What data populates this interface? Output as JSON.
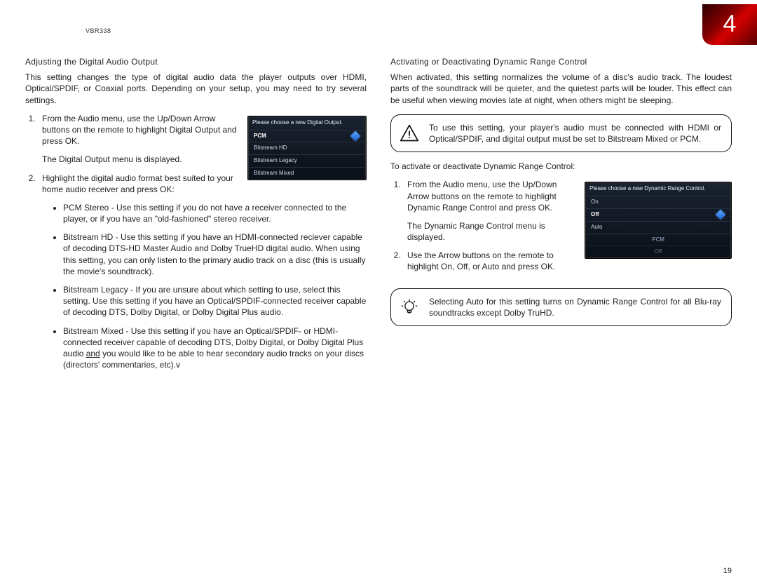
{
  "header": {
    "model": "VBR338",
    "chapter": "4"
  },
  "page_number": "19",
  "left": {
    "title": "Adjusting the Digital Audio Output",
    "intro": "This setting changes the type of digital audio data the player outputs over HDMI, Optical/SPDIF, or Coaxial ports. Depending on your setup, you may need to try several settings.",
    "step1_a": "From the Audio menu, use the ",
    "step1_b": "Up/Down Arrow",
    "step1_c": " buttons on the remote to highlight ",
    "step1_d": "Digital Output",
    "step1_e": " and press ",
    "step1_ok": "OK",
    "step1_f": ".",
    "step1_after": "The Digital Output menu is displayed.",
    "step2_a": "Highlight the digital audio format best suited to your home audio receiver and press ",
    "step2_ok": "OK",
    "step2_b": ":",
    "bullet_pcm_t": "PCM Stereo",
    "bullet_pcm": " - Use this setting if you do not have a receiver connected to the player, or if you have an \"old-fashioned\" stereo receiver.",
    "bullet_hd_t": "Bitstream HD",
    "bullet_hd": " - Use this setting if you have an HDMI-connected reciever capable of decoding DTS-HD Master Audio and Dolby TrueHD digital audio. When using this setting, you can only listen to the primary audio track on a disc (this is usually the movie's soundtrack).",
    "bullet_legacy_t": "Bitstream Legacy",
    "bullet_legacy_lead": " - ",
    "bullet_legacy_bold": "If you are unsure about which setting to use, select this setting.",
    "bullet_legacy": " Use this setting if you have an Optical/SPDIF-connected receiver capable of decoding DTS, Dolby Digital, or Dolby Digital Plus audio.",
    "bullet_mixed_t": "Bitstream Mixed",
    "bullet_mixed_a": " - Use this setting if you have an Optical/SPDIF- or HDMI-connected receiver capable of decoding DTS, Dolby Digital, or Dolby Digital Plus audio ",
    "bullet_mixed_and": "and",
    "bullet_mixed_b": " you would like to be able to hear secondary audio tracks on your discs (directors' commentaries, etc).v",
    "ss": {
      "title": "Please choose a new Digital Output.",
      "opts": [
        "PCM",
        "Bitstream HD",
        "Bitstream Legacy",
        "Bitstream Mixed"
      ]
    }
  },
  "right": {
    "title": "Activating or Deactivating Dynamic Range Control",
    "intro": "When activated, this setting normalizes the volume of a disc's audio track. The loudest parts of the soundtrack will be quieter, and the quietest parts will be louder. This effect can be useful when viewing movies late at night, when others might be sleeping.",
    "warn_a": "To use this setting, your player's audio must be connected with HDMI or Optical/SPDIF, and digital output must be set to ",
    "warn_b": "Bitstream Mixed",
    "warn_c": " or ",
    "warn_d": "PCM",
    "warn_e": ".",
    "lead": "To activate or deactivate Dynamic Range Control:",
    "step1_a": "From the Audio menu, use the ",
    "step1_b": "Up/Down Arrow",
    "step1_c": " buttons on the remote to highlight ",
    "step1_d": "Dynamic Range Control",
    "step1_e": " and press ",
    "step1_ok": "OK",
    "step1_f": ".",
    "step1_after": "The Dynamic Range Control menu is displayed.",
    "step2_a": "Use the ",
    "step2_arrow": "Arrow",
    "step2_b": " buttons on the remote to highlight ",
    "step2_on": "On",
    "step2_c": ", ",
    "step2_off": "Off",
    "step2_d": ", or ",
    "step2_auto": "Auto",
    "step2_e": " and press ",
    "step2_ok": "OK",
    "step2_f": ".",
    "tip_a": "Selecting ",
    "tip_auto": "Auto",
    "tip_b": " for this setting turns on Dynamic Range Control for all Blu-ray soundtracks except Dolby TruHD.",
    "ss": {
      "title": "Please choose a new Dynamic Range Control.",
      "opts": [
        "On",
        "Off",
        "Auto"
      ],
      "bottom1": "PCM",
      "bottom2": "Off"
    }
  }
}
